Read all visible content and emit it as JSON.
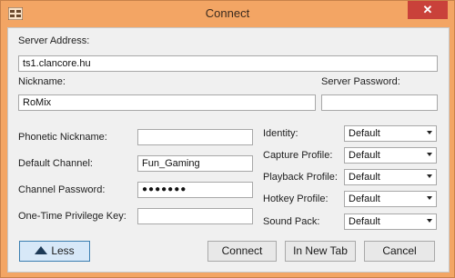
{
  "window": {
    "title": "Connect",
    "close_label": "✕"
  },
  "server_address": {
    "label": "Server Address:",
    "value": "ts1.clancore.hu"
  },
  "nickname": {
    "label": "Nickname:",
    "value": "RoMix"
  },
  "server_password": {
    "label": "Server Password:",
    "value": ""
  },
  "phonetic_nickname": {
    "label": "Phonetic Nickname:",
    "value": ""
  },
  "default_channel": {
    "label": "Default Channel:",
    "value": "Fun_Gaming"
  },
  "channel_password": {
    "label": "Channel Password:",
    "value": "●●●●●●●"
  },
  "privilege_key": {
    "label": "One-Time Privilege Key:",
    "value": ""
  },
  "profiles": [
    {
      "label": "Identity:",
      "selected": "Default"
    },
    {
      "label": "Capture Profile:",
      "selected": "Default"
    },
    {
      "label": "Playback Profile:",
      "selected": "Default"
    },
    {
      "label": "Hotkey Profile:",
      "selected": "Default"
    },
    {
      "label": "Sound Pack:",
      "selected": "Default"
    }
  ],
  "buttons": {
    "less": "Less",
    "connect": "Connect",
    "new_tab": "In New Tab",
    "cancel": "Cancel"
  }
}
